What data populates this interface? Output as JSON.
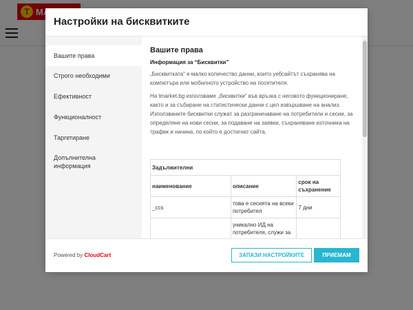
{
  "background": {
    "logo_mark": "T",
    "logo_text": "MA"
  },
  "modal": {
    "title": "Настройки на бисквитките"
  },
  "sidebar": {
    "items": [
      {
        "label": "Вашите права"
      },
      {
        "label": "Строго необходими"
      },
      {
        "label": "Ефективност"
      },
      {
        "label": "Функционалност"
      },
      {
        "label": "Таргетиране"
      },
      {
        "label": "Допълнителна информация"
      }
    ]
  },
  "content": {
    "heading": "Вашите права",
    "subheading": "Информация за “Бисквитки”",
    "para1": "„Бисквитката“ е малко количество данни, които уебсайтът съхранява на компютъра или мобилното устройство на посетителя.",
    "para2": "На tmarket.bg използваме „бисквитки“ във връзка с неговото функциониране, както и за събиране на статистически данни с цел извършване на анализ. Използваните бисквитки служат за разграничаване на потребители и сесии, за определяне на нови сесии, за подаване на заявки, съхраняване източника на трафик и начина, по който е достигнат сайта.",
    "table": {
      "section": "Задължителни",
      "headers": [
        "наименование",
        "описание",
        "срок на съхранение"
      ],
      "rows": [
        [
          "_ccs",
          "това е сесията на всеки потребител",
          "7 дни"
        ],
        [
          "",
          "уникално ИД на потребителя, служи за подаване на",
          ""
        ]
      ]
    }
  },
  "footer": {
    "powered_by": "Powered by",
    "brand": "CloudCart",
    "save_label": "ЗАПАЗИ НАСТРОЙКИТЕ",
    "accept_label": "ПРИЕМАМ"
  },
  "colors": {
    "accent": "#29b6d1",
    "brand_red": "#e30613"
  }
}
